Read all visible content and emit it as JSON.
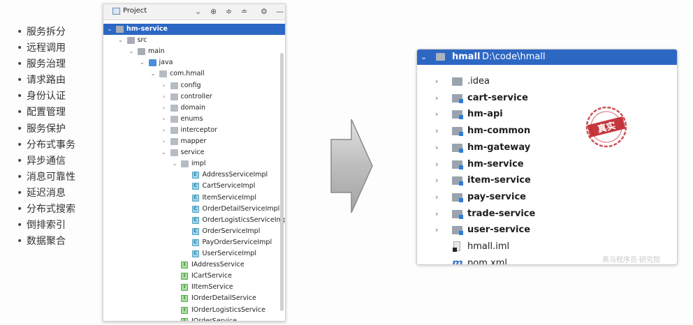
{
  "bullets": [
    "服务拆分",
    "远程调用",
    "服务治理",
    "请求路由",
    "身份认证",
    "配置管理",
    "服务保护",
    "分布式事务",
    "异步通信",
    "消息可靠性",
    "延迟消息",
    "分布式搜索",
    "倒排索引",
    "数据聚合"
  ],
  "project_panel": {
    "title": "Project",
    "tree": [
      {
        "label": "hm-service",
        "depth": 0,
        "chevron": "down",
        "icon": "module-folder-icon",
        "selected": true
      },
      {
        "label": "src",
        "depth": 1,
        "chevron": "down",
        "icon": "folder-icon"
      },
      {
        "label": "main",
        "depth": 2,
        "chevron": "down",
        "icon": "folder-icon"
      },
      {
        "label": "java",
        "depth": 3,
        "chevron": "down",
        "icon": "source-folder-icon"
      },
      {
        "label": "com.hmall",
        "depth": 4,
        "chevron": "down",
        "icon": "package-icon"
      },
      {
        "label": "config",
        "depth": 5,
        "chevron": "right",
        "icon": "package-icon"
      },
      {
        "label": "controller",
        "depth": 5,
        "chevron": "right",
        "icon": "package-icon"
      },
      {
        "label": "domain",
        "depth": 5,
        "chevron": "right",
        "icon": "package-icon"
      },
      {
        "label": "enums",
        "depth": 5,
        "chevron": "right",
        "icon": "package-icon"
      },
      {
        "label": "interceptor",
        "depth": 5,
        "chevron": "right",
        "icon": "package-icon"
      },
      {
        "label": "mapper",
        "depth": 5,
        "chevron": "right",
        "icon": "package-icon"
      },
      {
        "label": "service",
        "depth": 5,
        "chevron": "down",
        "icon": "package-icon"
      },
      {
        "label": "impl",
        "depth": 6,
        "chevron": "down",
        "icon": "package-icon"
      },
      {
        "label": "AddressServiceImpl",
        "depth": 7,
        "chevron": "",
        "icon": "class-icon"
      },
      {
        "label": "CartServiceImpl",
        "depth": 7,
        "chevron": "",
        "icon": "class-icon"
      },
      {
        "label": "ItemServiceImpl",
        "depth": 7,
        "chevron": "",
        "icon": "class-icon"
      },
      {
        "label": "OrderDetailServiceImpl",
        "depth": 7,
        "chevron": "",
        "icon": "class-icon"
      },
      {
        "label": "OrderLogisticsServiceImpl",
        "depth": 7,
        "chevron": "",
        "icon": "class-icon"
      },
      {
        "label": "OrderServiceImpl",
        "depth": 7,
        "chevron": "",
        "icon": "class-icon"
      },
      {
        "label": "PayOrderServiceImpl",
        "depth": 7,
        "chevron": "",
        "icon": "class-icon"
      },
      {
        "label": "UserServiceImpl",
        "depth": 7,
        "chevron": "",
        "icon": "class-icon"
      },
      {
        "label": "IAddressService",
        "depth": 6,
        "chevron": "",
        "icon": "interface-icon"
      },
      {
        "label": "ICartService",
        "depth": 6,
        "chevron": "",
        "icon": "interface-icon"
      },
      {
        "label": "IItemService",
        "depth": 6,
        "chevron": "",
        "icon": "interface-icon"
      },
      {
        "label": "IOrderDetailService",
        "depth": 6,
        "chevron": "",
        "icon": "interface-icon"
      },
      {
        "label": "IOrderLogisticsService",
        "depth": 6,
        "chevron": "",
        "icon": "interface-icon"
      },
      {
        "label": "IOrderService",
        "depth": 6,
        "chevron": "",
        "icon": "interface-icon"
      }
    ]
  },
  "hmall_panel": {
    "root_name": "hmall",
    "root_path": "D:\\code\\hmall",
    "items": [
      {
        "label": ".idea",
        "type": "folder",
        "bold": false
      },
      {
        "label": "cart-service",
        "type": "module",
        "bold": true
      },
      {
        "label": "hm-api",
        "type": "module",
        "bold": true
      },
      {
        "label": "hm-common",
        "type": "module",
        "bold": true
      },
      {
        "label": "hm-gateway",
        "type": "module",
        "bold": true
      },
      {
        "label": "hm-service",
        "type": "module",
        "bold": true
      },
      {
        "label": "item-service",
        "type": "module",
        "bold": true
      },
      {
        "label": "pay-service",
        "type": "module",
        "bold": true
      },
      {
        "label": "trade-service",
        "type": "module",
        "bold": true
      },
      {
        "label": "user-service",
        "type": "module",
        "bold": true
      },
      {
        "label": "hmall.iml",
        "type": "iml",
        "bold": false
      },
      {
        "label": "pom.xml",
        "type": "maven",
        "bold": false
      }
    ]
  },
  "stamp_text": "真实",
  "watermark": "黑马程序员·研究院",
  "colors": {
    "selection": "#2d67c4",
    "stamp": "#c0262d"
  }
}
